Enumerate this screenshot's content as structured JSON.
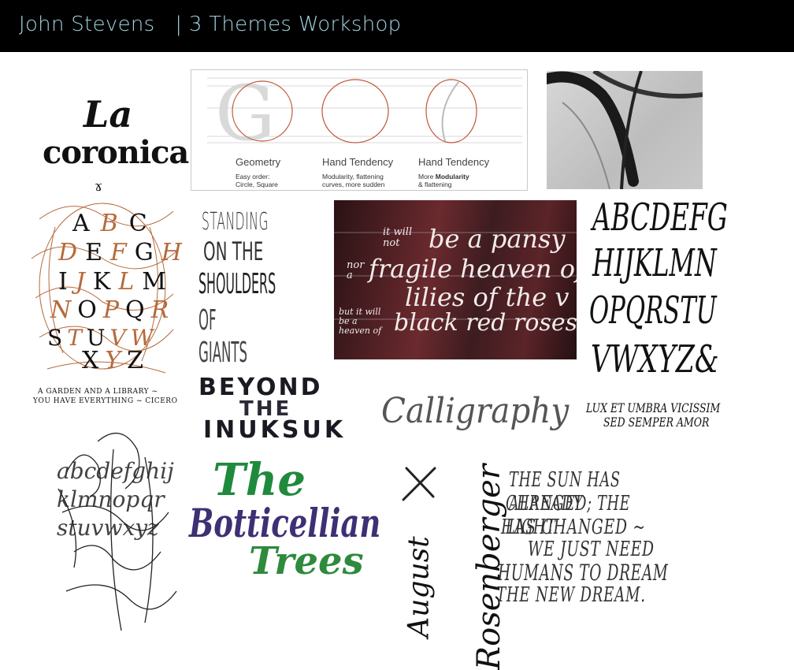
{
  "header": {
    "title": "John Stevens   | 3 Themes Workshop",
    "background": "#000000",
    "title_color": "#9fd2df"
  },
  "works": {
    "la_coronica": {
      "line1": "La",
      "line2": "coronica"
    },
    "alphabet_circle": {
      "letters": [
        "A",
        "B",
        "C",
        "D",
        "E",
        "F",
        "G",
        "H",
        "I",
        "J",
        "K",
        "L",
        "M",
        "N",
        "O",
        "P",
        "Q",
        "R",
        "S",
        "T",
        "U",
        "V",
        "W",
        "X",
        "Y",
        "Z"
      ],
      "caption_line1": "A GARDEN AND A LIBRARY ~",
      "caption_line2": "YOU HAVE EVERYTHING ~ CICERO"
    },
    "geometry_diagram": {
      "letters": [
        "G",
        "O",
        "O"
      ],
      "columns": [
        {
          "title": "Geometry",
          "sub1": "Easy order:",
          "sub2": "Circle, Square",
          "sub2_bold": ""
        },
        {
          "title": "Hand Tendency",
          "sub1": "Modularity, flattening",
          "sub2": "curves, more sudden",
          "sub2_bold": ""
        },
        {
          "title": "Hand Tendency",
          "sub1": "More ",
          "sub1_bold": "Modularity",
          "sub2": "& flattening"
        }
      ]
    },
    "standing": {
      "lines": [
        "STANDING",
        "ON THE",
        "SHOULDERS",
        "OF GIANTS"
      ]
    },
    "pansy": {
      "lines": [
        {
          "small": "it will not",
          "big": "be a pansy"
        },
        {
          "small": "nor a",
          "big": "fragile heaven of"
        },
        {
          "small": "",
          "big": "lilies of the v"
        },
        {
          "small": "but it will be a heaven of",
          "big": "black red roses"
        }
      ]
    },
    "alphabet_chancery": {
      "rows": [
        "ABCDEFG",
        "HIJKLMN",
        "OPQRSTU",
        "VWXYZ&"
      ]
    },
    "beyond": {
      "lines": [
        "BEYOND",
        "THE",
        "INUKSUK"
      ]
    },
    "calligraphy": {
      "text": "Calligraphy"
    },
    "lux": {
      "line1": "LUX ET UMBRA VICISSIM",
      "line2": "SED SEMPER AMOR"
    },
    "loose_alphabet": {
      "text": "abcdefghijklmnopqrstuvwxyz"
    },
    "botticellian": {
      "line1": "The",
      "line2": "Botticellian",
      "line3": "Trees"
    },
    "august": {
      "line1": "August",
      "line2": "Rosenberger"
    },
    "sun": {
      "lines": [
        "THE SUN HAS ALREADY",
        "CHANGED; THE LIGHT",
        "HAS CHANGED ~",
        "WE JUST NEED",
        "HUMANS TO DREAM",
        "THE NEW DREAM."
      ]
    }
  },
  "colors": {
    "ink": "#111111",
    "copper": "#b66a3c",
    "green": "#1f8a3c",
    "purple": "#4b2a6e",
    "red_diagram": "#c0563a",
    "header_text": "#9fd2df"
  }
}
